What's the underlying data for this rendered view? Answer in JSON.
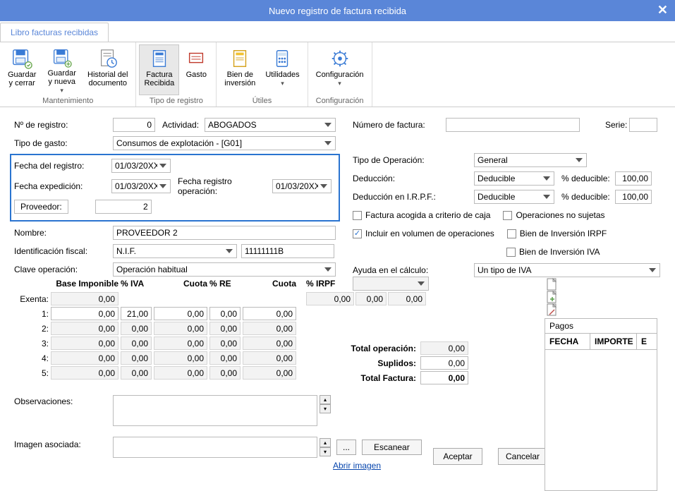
{
  "window": {
    "title": "Nuevo registro de factura recibida"
  },
  "tab": {
    "label": "Libro facturas recibidas"
  },
  "ribbon": {
    "guardar_cerrar": "Guardar\ny cerrar",
    "guardar_nueva": "Guardar\n y nueva ",
    "historial": "Historial del\ndocumento",
    "factura_recibida": "Factura\nRecibida",
    "gasto": "Gasto",
    "bien_inversion": "Bien de\ninversión",
    "utilidades": "Utilidades\n",
    "configuracion": "Configuración\n",
    "group_mantenimiento": "Mantenimiento",
    "group_tipo_registro": "Tipo de registro",
    "group_utiles": "Útiles",
    "group_configuracion": "Configuración"
  },
  "form": {
    "l_nregistro": "Nº de registro:",
    "v_nregistro": "0",
    "l_actividad": "Actividad:",
    "v_actividad": "ABOGADOS",
    "l_tipogasto": "Tipo de gasto:",
    "v_tipogasto": "Consumos de explotación - [G01]",
    "l_fecharegistro": "Fecha del registro:",
    "v_fecharegistro": "01/03/20XX",
    "l_fechaexped": "Fecha expedición:",
    "v_fechaexped": "01/03/20XX",
    "l_fecharegop": "Fecha registro operación:",
    "v_fecharegop": "01/03/20XX",
    "l_proveedor": "Proveedor:",
    "v_proveedor": "2",
    "l_nombre": "Nombre:",
    "v_nombre": "PROVEEDOR 2",
    "l_idfiscal": "Identificación fiscal:",
    "v_idfiscal_tipo": "N.I.F.",
    "v_idfiscal_num": "11111111B",
    "l_claveop": "Clave operación:",
    "v_claveop": "Operación habitual",
    "l_numfactura": "Número de factura:",
    "v_numfactura": "",
    "l_serie": "Serie:",
    "v_serie": "",
    "l_tipoop": "Tipo de Operación:",
    "v_tipoop": "General",
    "l_deduccion": "Deducción:",
    "v_deduccion": "Deducible",
    "l_pctdeducible1": "% deducible:",
    "v_pctdeducible1": "100,00",
    "l_deduccion_irpf": "Deducción en I.R.P.F.:",
    "v_deduccion_irpf": "Deducible",
    "l_pctdeducible2": "% deducible:",
    "v_pctdeducible2": "100,00",
    "chk_factcaja": "Factura acogida a criterio de caja",
    "chk_opnosujetas": "Operaciones no sujetas",
    "chk_incluirvol": "Incluir en  volumen de operaciones",
    "chk_bieninv_irpf": "Bien de Inversión IRPF",
    "chk_bieninv_iva": "Bien de Inversión IVA",
    "l_ayudacalc": "Ayuda en el cálculo:",
    "v_ayudacalc": "Un tipo de IVA"
  },
  "grid": {
    "h_base": "Base Imponible",
    "h_piva": "% IVA",
    "h_cuota1": "Cuota",
    "h_pre": "% RE",
    "h_cuota2": "Cuota",
    "h_pirpf": "% IRPF",
    "l_exenta": "Exenta:",
    "l_1": "1:",
    "l_2": "2:",
    "l_3": "3:",
    "l_4": "4:",
    "l_5": "5:",
    "rows": {
      "exenta": {
        "base": "0,00"
      },
      "r1": {
        "base": "0,00",
        "piva": "21,00",
        "cuota1": "0,00",
        "pre": "0,00",
        "cuota2": "0,00"
      },
      "r2": {
        "base": "0,00",
        "piva": "0,00",
        "cuota1": "0,00",
        "pre": "0,00",
        "cuota2": "0,00"
      },
      "r3": {
        "base": "0,00",
        "piva": "0,00",
        "cuota1": "0,00",
        "pre": "0,00",
        "cuota2": "0,00"
      },
      "r4": {
        "base": "0,00",
        "piva": "0,00",
        "cuota1": "0,00",
        "pre": "0,00",
        "cuota2": "0,00"
      },
      "r5": {
        "base": "0,00",
        "piva": "0,00",
        "cuota1": "0,00",
        "pre": "0,00",
        "cuota2": "0,00"
      }
    },
    "irpf_val1": "0,00",
    "irpf_val2": "0,00",
    "irpf_val3": "0,00"
  },
  "totals": {
    "l_totop": "Total operación:",
    "v_totop": "0,00",
    "l_suplidos": "Suplidos:",
    "v_suplidos": "0,00",
    "l_totfact": "Total Factura:",
    "v_totfact": "0,00"
  },
  "obs": {
    "label": "Observaciones:",
    "value": ""
  },
  "img": {
    "label": "Imagen asociada:",
    "value": "",
    "browse": "...",
    "scan": "Escanear",
    "open": "Abrir imagen"
  },
  "btns": {
    "aceptar": "Aceptar",
    "cancelar": "Cancelar"
  },
  "pagos": {
    "title": "Pagos",
    "col_fecha": "FECHA",
    "col_importe": "IMPORTE",
    "col_e": "E"
  }
}
